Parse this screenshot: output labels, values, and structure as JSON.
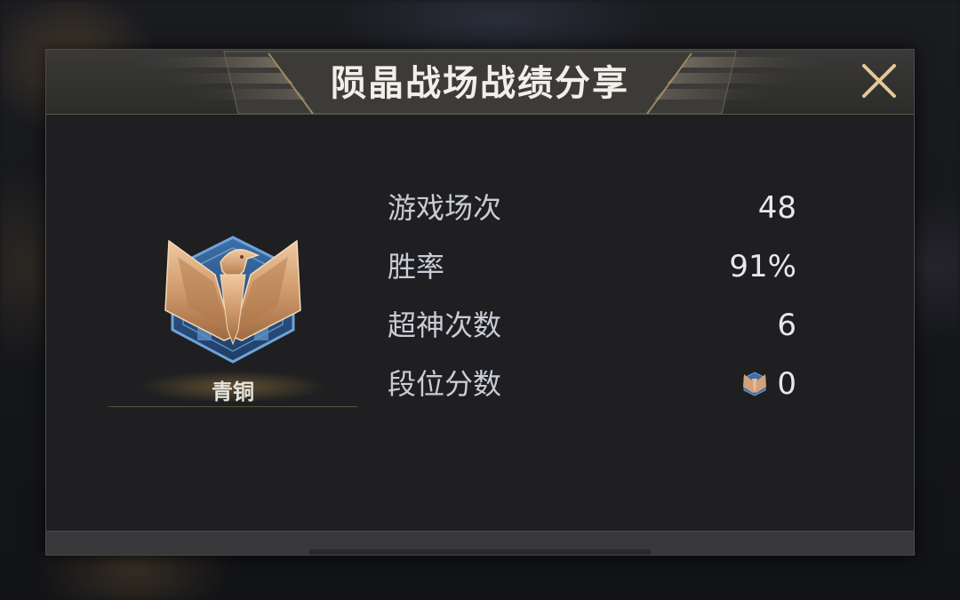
{
  "dialog": {
    "title": "陨晶战场战绩分享"
  },
  "rank": {
    "name": "青铜",
    "icon": "bronze-eagle-emblem-icon"
  },
  "stats": [
    {
      "label": "游戏场次",
      "value": "48"
    },
    {
      "label": "胜率",
      "value": "91%"
    },
    {
      "label": "超神次数",
      "value": "6"
    },
    {
      "label": "段位分数",
      "value": "0",
      "icon": "rank-score-icon"
    }
  ],
  "colors": {
    "title": "#f1efe9",
    "label": "#c9ccd6",
    "value": "#e8e8ea",
    "bronze": "#c9986a",
    "emblem_blue": "#4a7fb8"
  }
}
